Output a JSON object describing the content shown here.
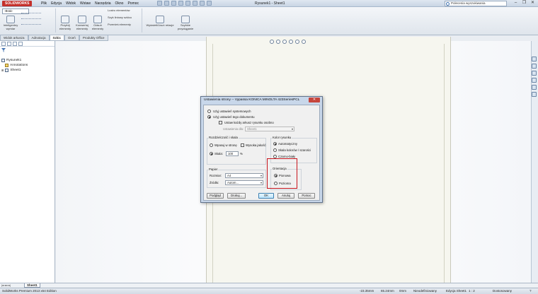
{
  "app": {
    "logo": "SOLIDWORKS",
    "document_title": "Rysunek1 - Sheet1",
    "menu": [
      "Plik",
      "Edycja",
      "Widok",
      "Wstaw",
      "Narzędzia",
      "Okno",
      "Pomoc"
    ],
    "help_search_placeholder": "Polecenia wyszukiwania"
  },
  "ribbon": {
    "style_select": "-Brak-",
    "tools": [
      {
        "label": "Inteligentny wymiar"
      },
      {
        "label": "Przytnij elementy"
      },
      {
        "label": "Konwertuj elementy"
      },
      {
        "label": "Odsuń elementy"
      },
      {
        "label": "Wyświetl/Usuń relacje"
      },
      {
        "label": "Szybkie przyciąganie"
      }
    ],
    "mirror_label": "Lustro elementów",
    "pattern_label": "Szyk liniowy szkicu",
    "move_label": "Przenieś elementy"
  },
  "cm_tabs": [
    "Widok arkusza",
    "Adnotacja",
    "Szkic",
    "Oceń",
    "Produkty Office"
  ],
  "cm_active_tab": 2,
  "tree": {
    "root": "Rysunek1",
    "items": [
      "Annotations",
      "Sheet1"
    ]
  },
  "dialog": {
    "title": "Ustawienia strony -- Vypassa ",
    "title_printer": "KONICA MINOLTA 423SeriesPCL",
    "close": "✕",
    "use_system": "Użyj ustawień systemowych",
    "use_document": "Użyj ustawień tego dokumentu",
    "different_per_sheet": "Ustaw każdy arkusz rysunku osobno",
    "settings_for_label": "Ustawienia dla:",
    "settings_for_value": "Sheet1",
    "resolution_group": "Rozdzielczość i skala",
    "fit_to_page": "Wpasuj w stronę",
    "high_quality": "Wysoka jakość",
    "scale_label": "Skala:",
    "scale_value": "100",
    "scale_unit": "%",
    "paper_group": "Papier",
    "size_label": "Rozmiar:",
    "size_value": "A4",
    "source_label": "Źródło:",
    "source_value": "Autom...",
    "color_group": "Kolor rysunku",
    "color_auto": "Automatyczny",
    "color_gray": "Skala kolorów / szarości",
    "color_bw": "Czarno-biały",
    "orientation_group": "Orientacja",
    "portrait": "Pionowa",
    "landscape": "Pozioma",
    "btn_preview": "Podgląd",
    "btn_print": "Drukuj...",
    "btn_ok": "OK",
    "btn_cancel": "Anuluj",
    "btn_help": "Pomoc"
  },
  "sheet_tab": "Sheet1",
  "status": {
    "edition": "SolidWorks Premium 2013 x64 Edition",
    "x": "-23.35mm",
    "y": "65.24mm",
    "z": "0mm",
    "state": "Nieodefiniowany",
    "editing": "Edycja Sheet1",
    "scale": "1 : 2",
    "units": "Dostosowany"
  }
}
